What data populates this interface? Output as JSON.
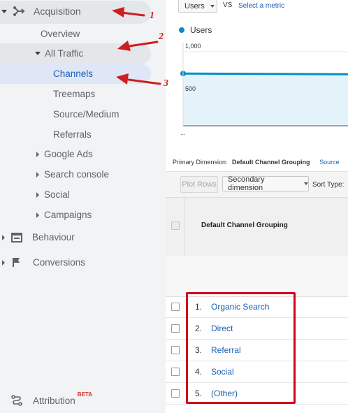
{
  "sidebar": {
    "acquisition": "Acquisition",
    "overview": "Overview",
    "all_traffic": "All Traffic",
    "channels": "Channels",
    "treemaps": "Treemaps",
    "source_medium": "Source/Medium",
    "referrals": "Referrals",
    "google_ads": "Google Ads",
    "search_console": "Search console",
    "social": "Social",
    "campaigns": "Campaigns",
    "behaviour": "Behaviour",
    "conversions": "Conversions",
    "attribution": "Attribution",
    "attribution_badge": "BETA"
  },
  "annotations": {
    "one": "1",
    "two": "2",
    "three": "3"
  },
  "toolbar": {
    "metric_select": "Users",
    "vs": "VS",
    "select_metric": "Select a metric"
  },
  "chart_data": {
    "type": "area",
    "series": [
      {
        "name": "Users",
        "values": [
          700,
          690
        ]
      }
    ],
    "yticks": [
      "1,000",
      "500"
    ],
    "ylim": [
      0,
      1000
    ],
    "x_label_fragment": "..."
  },
  "table": {
    "primary_dimension_label": "Primary Dimension:",
    "primary_dimension_value": "Default Channel Grouping",
    "primary_dimension_alt": "Source",
    "plot_rows": "Plot Rows",
    "secondary_dimension": "Secondary dimension",
    "sort_type": "Sort Type:",
    "column_header": "Default Channel Grouping",
    "rows": [
      {
        "index": "1.",
        "label": "Organic Search"
      },
      {
        "index": "2.",
        "label": "Direct"
      },
      {
        "index": "3.",
        "label": "Referral"
      },
      {
        "index": "4.",
        "label": "Social"
      },
      {
        "index": "5.",
        "label": "(Other)"
      }
    ]
  },
  "colors": {
    "accent": "#1a73e8",
    "series": "#058dc7",
    "annotation": "#cc1f1f",
    "highlight_box": "#d0021b"
  }
}
